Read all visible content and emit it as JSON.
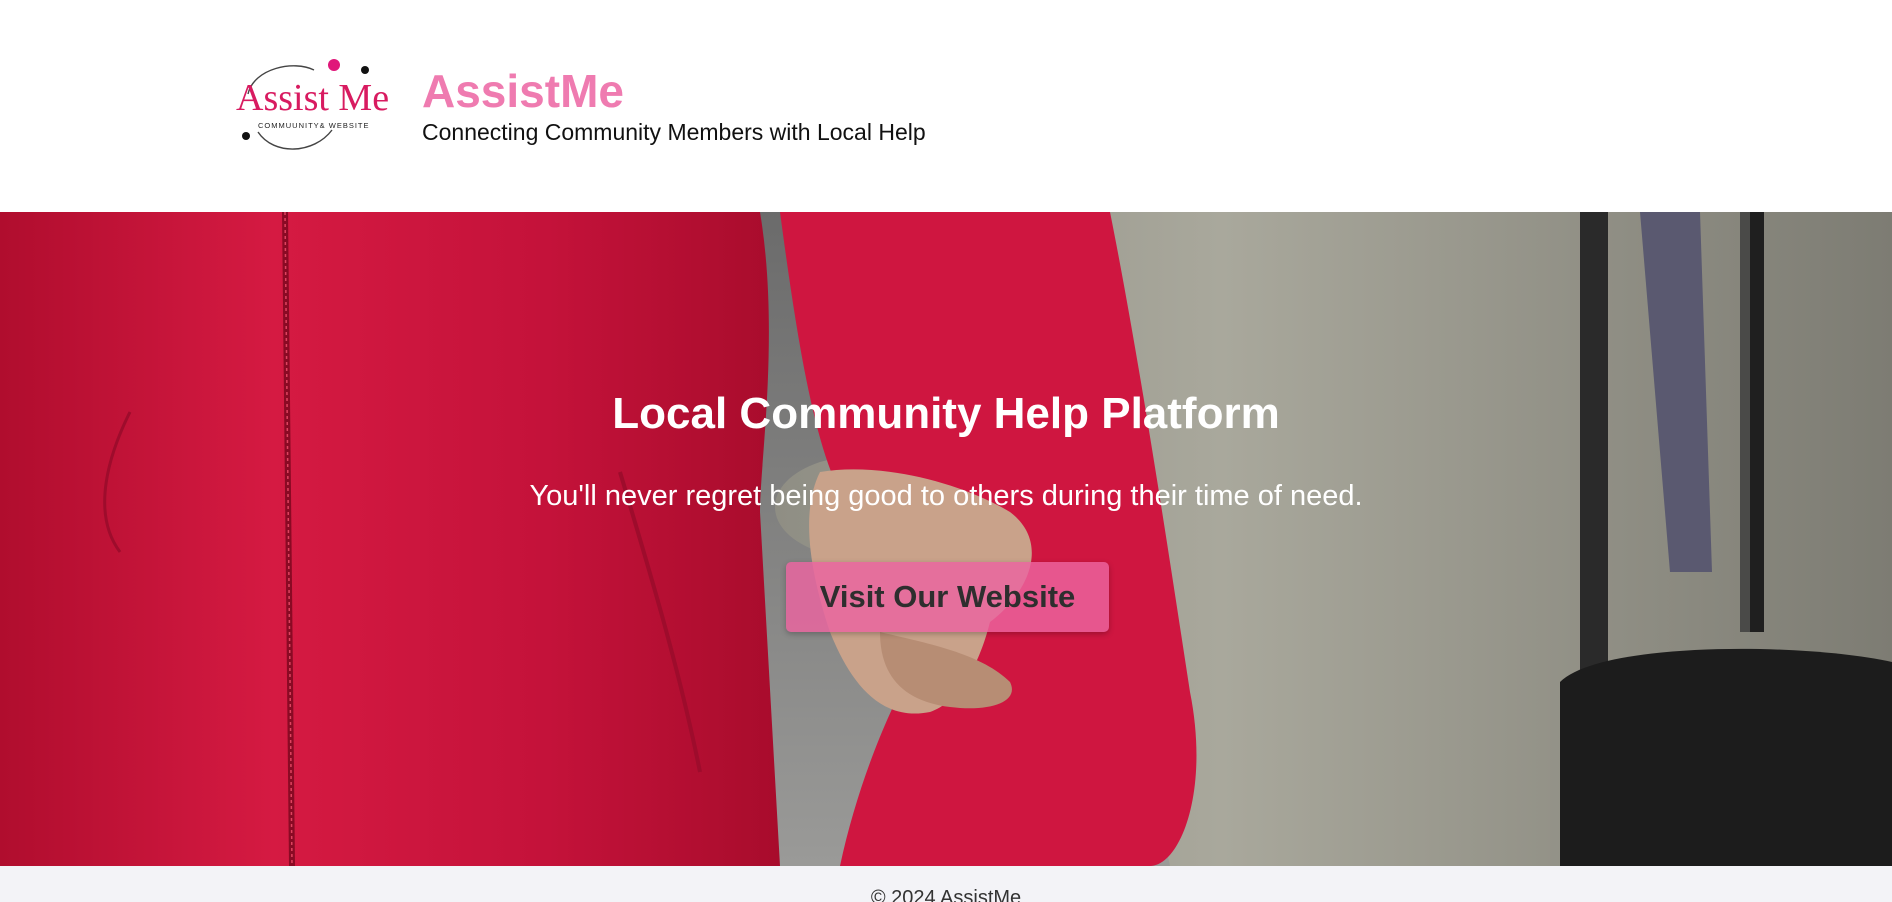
{
  "header": {
    "logo": {
      "script_text": "Assist Me",
      "small_text": "COMMUUNITY& WEBSITE"
    },
    "title": "AssistMe",
    "tagline": "Connecting Community Members with Local Help"
  },
  "hero": {
    "heading": "Local Community Help Platform",
    "subheading": "You'll never regret being good to others during their time of need.",
    "button_label": "Visit Our Website"
  },
  "footer": {
    "text": "© 2024 AssistMe"
  },
  "colors": {
    "brand_pink": "#ef7bb0",
    "button_pink": "#ec64a0",
    "jacket_red": "#d0103a",
    "fleece_grey": "#a8a79a",
    "footer_bg": "#f3f3f7"
  },
  "icons": {
    "logo": "assistme-logo-icon"
  }
}
